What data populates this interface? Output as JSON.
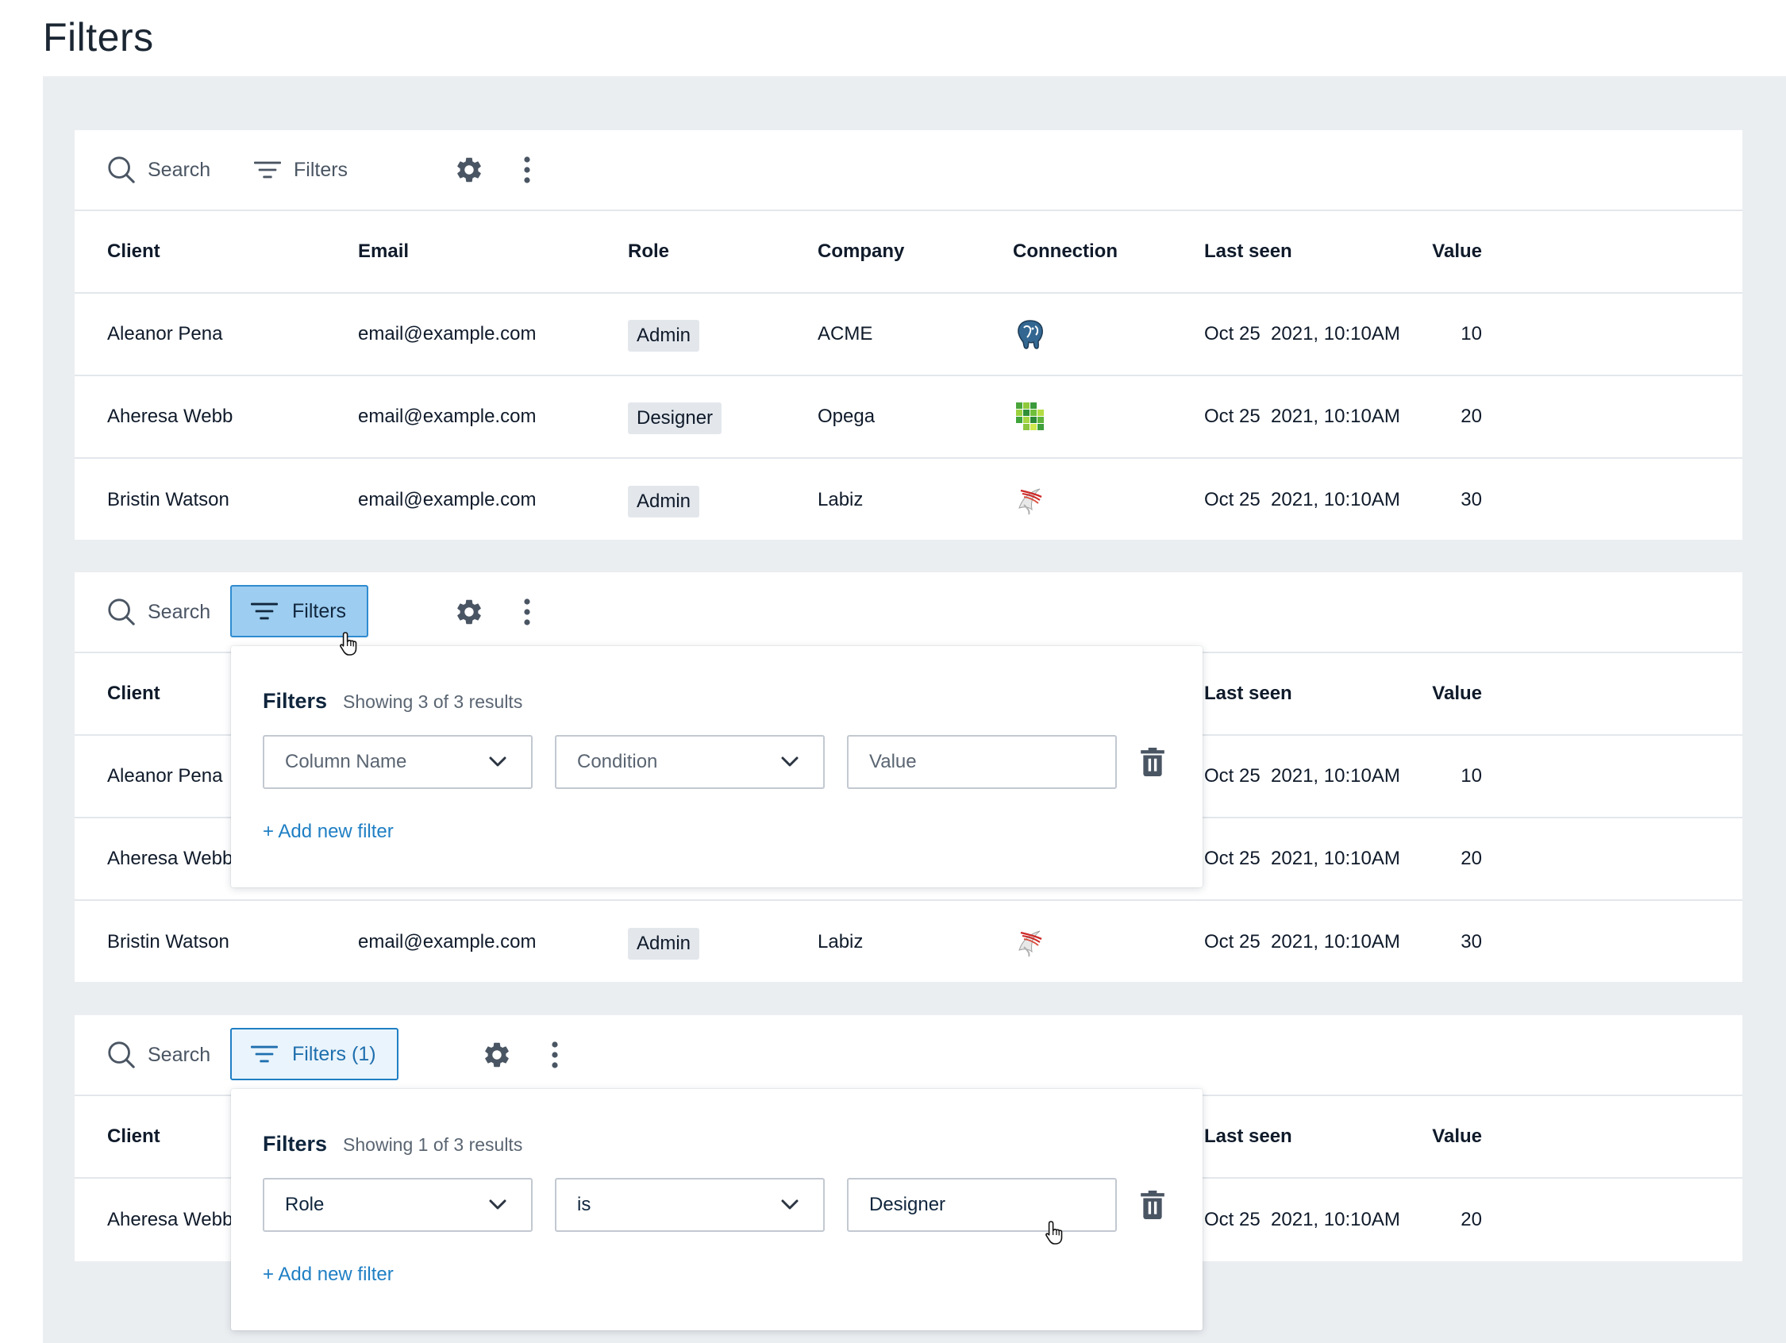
{
  "page": {
    "title": "Filters"
  },
  "toolbar": {
    "search_label": "Search",
    "filters_label": "Filters",
    "filters_applied_label": "Filters (1)",
    "settings_icon": "gear-icon",
    "more_icon": "kebab-icon"
  },
  "columns": {
    "client": "Client",
    "email": "Email",
    "role": "Role",
    "company": "Company",
    "connection": "Connection",
    "last_seen": "Last seen",
    "value": "Value"
  },
  "rows": [
    {
      "client": "Aleanor Pena",
      "email": "email@example.com",
      "role": "Admin",
      "company": "ACME",
      "connection": "postgresql-elephant-icon",
      "last_seen": "Oct 25  2021, 10:10AM",
      "value": "10"
    },
    {
      "client": "Aheresa Webb",
      "email": "email@example.com",
      "role": "Designer",
      "company": "Opega",
      "connection": "green-grid-database-icon",
      "last_seen": "Oct 25  2021, 10:10AM",
      "value": "20"
    },
    {
      "client": "Bristin Watson",
      "email": "email@example.com",
      "role": "Admin",
      "company": "Labiz",
      "connection": "sql-server-icon",
      "last_seen": "Oct 25  2021, 10:10AM",
      "value": "30"
    }
  ],
  "popover_empty": {
    "title": "Filters",
    "count": "Showing 3 of 3 results",
    "column_placeholder": "Column Name",
    "condition_placeholder": "Condition",
    "value_placeholder": "Value",
    "add_filter": "+ Add new filter"
  },
  "popover_applied": {
    "title": "Filters",
    "count": "Showing 1 of 3 results",
    "column_value": "Role",
    "condition_value": "is",
    "value_value": "Designer",
    "add_filter": "+ Add new filter"
  },
  "colors": {
    "canvas": "#ebeef1",
    "active_button_bg": "#9dcdf0",
    "active_button_border": "#2f8bd0",
    "applied_button_bg": "#eaf4fc",
    "link": "#1f7fc4",
    "badge_bg": "#e3e7ec"
  }
}
